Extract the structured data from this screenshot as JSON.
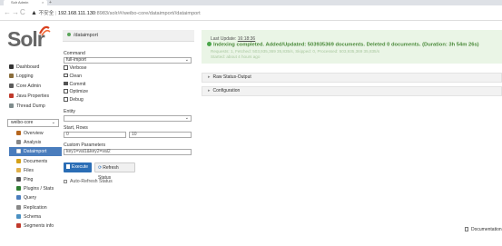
{
  "browser": {
    "tab_title": "Solr Admin",
    "url_warning": "不安全",
    "url_host": "192.168.111.130",
    "url_path": ":8983/solr/#/weibo-core/dataimport//dataimport"
  },
  "logo": {
    "text": "Solr"
  },
  "nav": {
    "items": [
      {
        "label": "Dashboard",
        "color": "#333333"
      },
      {
        "label": "Logging",
        "color": "#8a6d3b"
      },
      {
        "label": "Core Admin",
        "color": "#5b5b5b"
      },
      {
        "label": "Java Properties",
        "color": "#c0392b"
      },
      {
        "label": "Thread Dump",
        "color": "#7f8c8d"
      }
    ],
    "core_selector": "weibo-core",
    "core_items": [
      {
        "label": "Overview",
        "active": false,
        "color": "#b5651d"
      },
      {
        "label": "Analysis",
        "active": false,
        "color": "#888888"
      },
      {
        "label": "Dataimport",
        "active": true,
        "color": "#ffffff"
      },
      {
        "label": "Documents",
        "active": false,
        "color": "#d4a017"
      },
      {
        "label": "Files",
        "active": false,
        "color": "#e0b04a"
      },
      {
        "label": "Ping",
        "active": false,
        "color": "#555555"
      },
      {
        "label": "Plugins / Stats",
        "active": false,
        "color": "#2e7d32"
      },
      {
        "label": "Query",
        "active": false,
        "color": "#4a7dbd"
      },
      {
        "label": "Replication",
        "active": false,
        "color": "#888888"
      },
      {
        "label": "Schema",
        "active": false,
        "color": "#4a90c2"
      },
      {
        "label": "Segments info",
        "active": false,
        "color": "#c0392b"
      }
    ]
  },
  "form": {
    "header": "/dataimport",
    "command_label": "Command",
    "command_value": "full-import",
    "checkboxes": [
      {
        "label": "Verbose",
        "checked": false
      },
      {
        "label": "Clean",
        "checked": false
      },
      {
        "label": "Commit",
        "checked": true
      },
      {
        "label": "Optimize",
        "checked": false
      },
      {
        "label": "Debug",
        "checked": false
      }
    ],
    "entity_label": "Entity",
    "entity_value": "",
    "start_rows_label": "Start, Rows",
    "start_value": "0",
    "rows_value": "10",
    "custom_params_label": "Custom Parameters",
    "custom_params_value": "key1=val1&key2=val2",
    "execute_label": "Execute",
    "refresh_label": "Refresh Status",
    "auto_refresh_label": "Auto-Refresh Status"
  },
  "status": {
    "last_update_label": "Last Update:",
    "last_update_time": "16:18:36",
    "message": "Indexing completed. Added/Updated: 503935369 documents. Deleted 0 documents. (Duration: 3h 54m 26s)",
    "details": "Requests: 1, Fetched: 503,935,369 35,835/s, Skipped: 0, Processed: 503,935,369 35,835/s",
    "started": "Started: about 4 hours ago",
    "color_success": "#4a8a3a"
  },
  "panels": {
    "raw_status": "Raw Status-Output",
    "configuration": "Configuration"
  },
  "footer": {
    "documentation": "Documentation"
  }
}
